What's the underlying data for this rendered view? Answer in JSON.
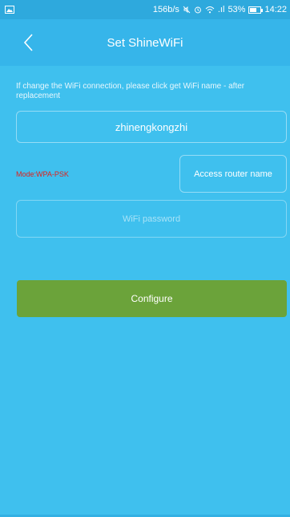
{
  "status_bar": {
    "left_icon": "gallery-icon",
    "speed": "156b/s",
    "icons": [
      "mute-icon",
      "alarm-icon",
      "wifi-icon",
      "signal-icon"
    ],
    "signal_text": ".ıl",
    "battery_percent": "53%",
    "battery_level": 0.53,
    "time": "14:22"
  },
  "header": {
    "back_icon": "chevron-left-icon",
    "title": "Set ShineWiFi"
  },
  "form": {
    "hint": "If change the WiFi connection, please click get WiFi name - after replacement",
    "ssid": "zhinengkongzhi",
    "mode": "Mode:WPA-PSK",
    "access_router_label": "Access router name",
    "password_placeholder": "WiFi password",
    "password_value": "",
    "configure_label": "Configure"
  },
  "colors": {
    "background": "#3fc0ee",
    "header": "#36b5ea",
    "configure_button": "#6ba33a",
    "mode_text": "#e0201b"
  }
}
